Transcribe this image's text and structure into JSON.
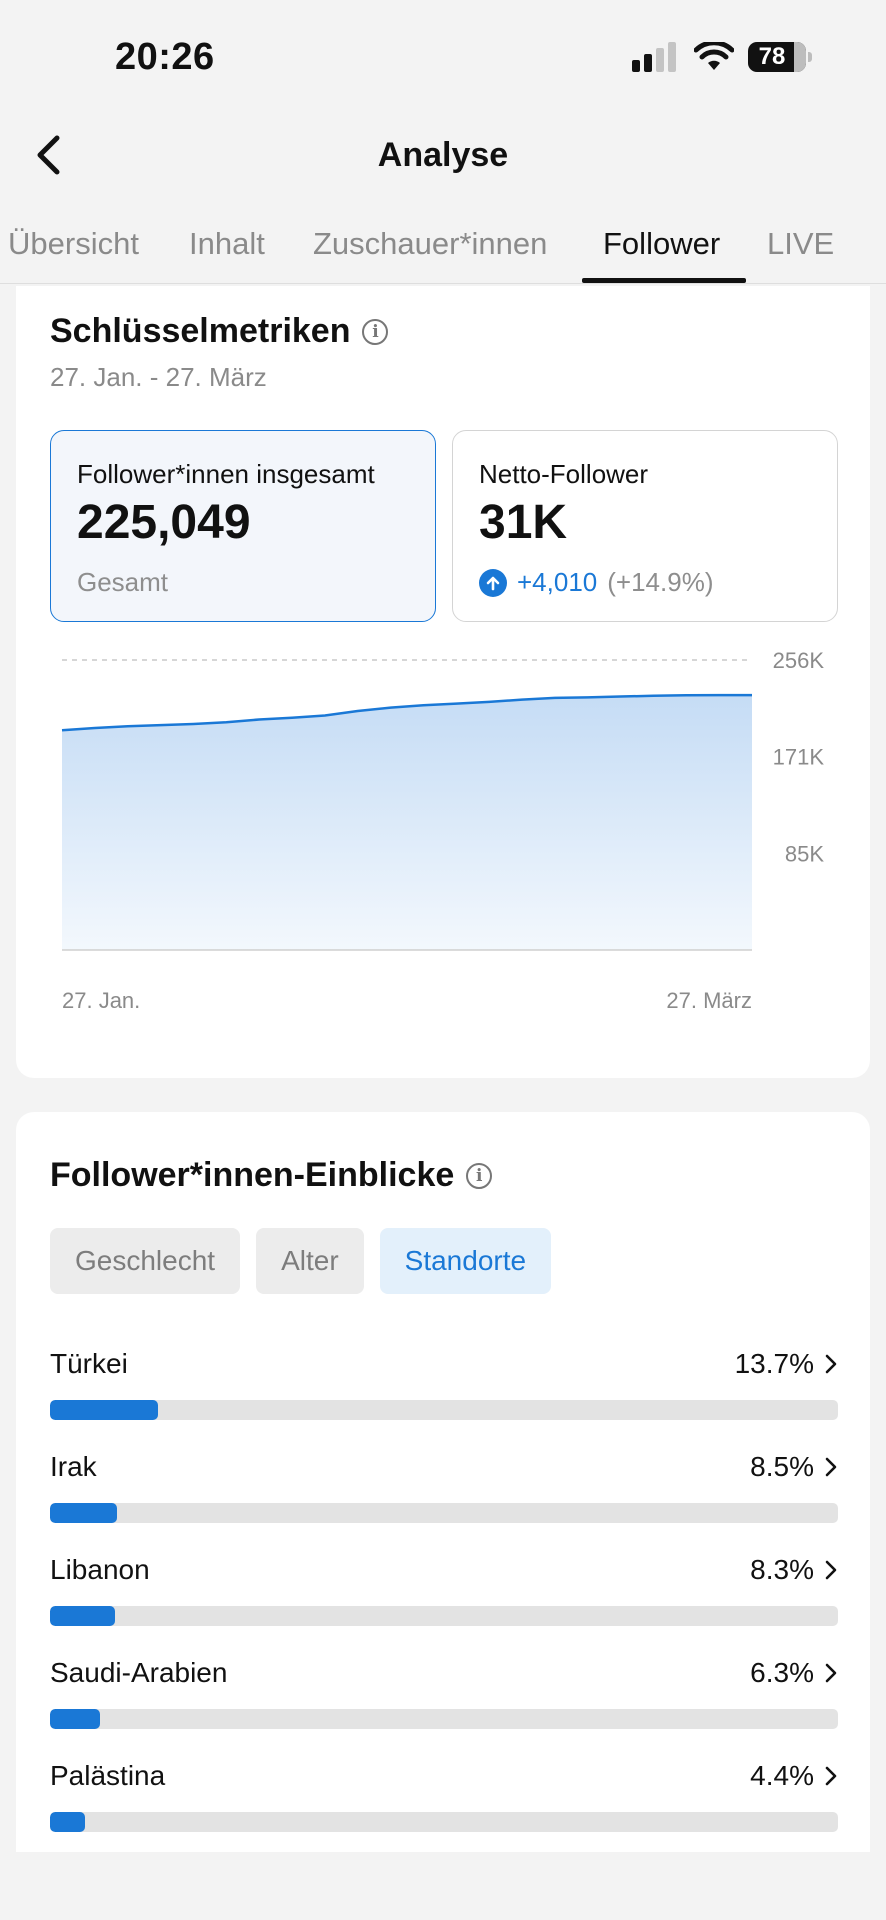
{
  "status_bar": {
    "time": "20:26",
    "battery": "78",
    "icons": [
      "signal-icon",
      "wifi-icon",
      "battery-icon"
    ]
  },
  "header": {
    "title": "Analyse",
    "back_icon": "chevron-left-icon"
  },
  "tabs": [
    {
      "label": "Übersicht",
      "active": false
    },
    {
      "label": "Inhalt",
      "active": false
    },
    {
      "label": "Zuschauer*innen",
      "active": false
    },
    {
      "label": "Follower",
      "active": true
    },
    {
      "label": "LIVE",
      "active": false
    }
  ],
  "metrics": {
    "title": "Schlüsselmetriken",
    "date_range": "27. Jan. - 27. März",
    "total": {
      "label": "Follower*innen insgesamt",
      "value": "225,049",
      "sub": "Gesamt"
    },
    "net": {
      "label": "Netto-Follower",
      "value": "31K",
      "delta": "+4,010",
      "delta_pct": "(+14.9%)"
    }
  },
  "chart_data": {
    "type": "area",
    "x_start_label": "27. Jan.",
    "x_end_label": "27. März",
    "y_ticks": [
      "256K",
      "171K",
      "85K"
    ],
    "ylim": [
      0,
      256000
    ],
    "grid": true,
    "values": [
      194000,
      196000,
      197500,
      198500,
      199500,
      201000,
      203500,
      205000,
      207000,
      211000,
      214000,
      216000,
      217500,
      219000,
      221000,
      222500,
      223000,
      223800,
      224400,
      224800,
      225000,
      225049
    ]
  },
  "insights": {
    "title": "Follower*innen-Einblicke",
    "filters": [
      {
        "label": "Geschlecht",
        "active": false
      },
      {
        "label": "Alter",
        "active": false
      },
      {
        "label": "Standorte",
        "active": true
      }
    ],
    "locations": [
      {
        "name": "Türkei",
        "pct_label": "13.7%",
        "pct": 13.7
      },
      {
        "name": "Irak",
        "pct_label": "8.5%",
        "pct": 8.5
      },
      {
        "name": "Libanon",
        "pct_label": "8.3%",
        "pct": 8.3
      },
      {
        "name": "Saudi-Arabien",
        "pct_label": "6.3%",
        "pct": 6.3
      },
      {
        "name": "Palästina",
        "pct_label": "4.4%",
        "pct": 4.4
      }
    ]
  }
}
